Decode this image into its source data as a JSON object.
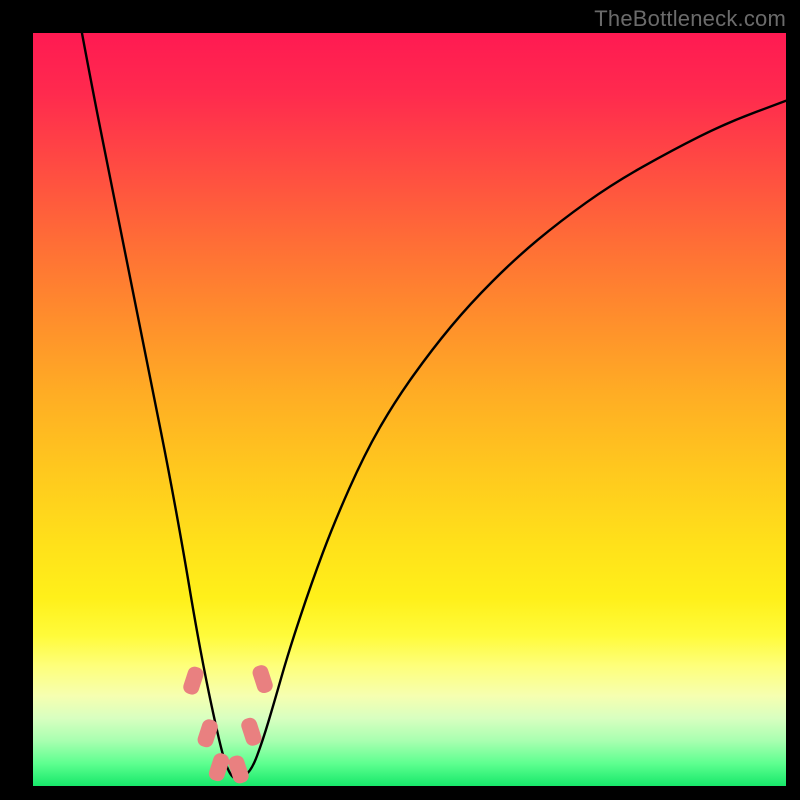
{
  "watermark": "TheBottleneck.com",
  "chart_data": {
    "type": "line",
    "title": "",
    "xlabel": "",
    "ylabel": "",
    "xlim": [
      0,
      100
    ],
    "ylim": [
      0,
      100
    ],
    "grid": false,
    "series": [
      {
        "name": "curve",
        "x": [
          6.5,
          8,
          10,
          12,
          14,
          16,
          18,
          20,
          21.5,
          23,
          24.5,
          25.5,
          26.5,
          27.5,
          29,
          30.5,
          32,
          34,
          37,
          40,
          44,
          48,
          53,
          58,
          64,
          70,
          77,
          85,
          92,
          100
        ],
        "y": [
          100,
          92,
          82,
          72,
          62,
          52,
          42,
          31,
          22,
          14,
          7,
          3,
          1,
          1,
          2,
          6,
          11,
          18,
          27,
          35,
          44,
          51,
          58,
          64,
          70,
          75,
          80,
          84.5,
          88,
          91
        ]
      }
    ],
    "markers": [
      {
        "x": 21.3,
        "y": 14.0
      },
      {
        "x": 23.2,
        "y": 7.0
      },
      {
        "x": 24.7,
        "y": 2.5
      },
      {
        "x": 27.3,
        "y": 2.2
      },
      {
        "x": 29.0,
        "y": 7.2
      },
      {
        "x": 30.5,
        "y": 14.2
      }
    ],
    "gradient_stops": [
      {
        "pos": 0.0,
        "color": "#ff1a52"
      },
      {
        "pos": 0.5,
        "color": "#ffc81e"
      },
      {
        "pos": 0.83,
        "color": "#feff7a"
      },
      {
        "pos": 1.0,
        "color": "#17e86a"
      }
    ]
  }
}
